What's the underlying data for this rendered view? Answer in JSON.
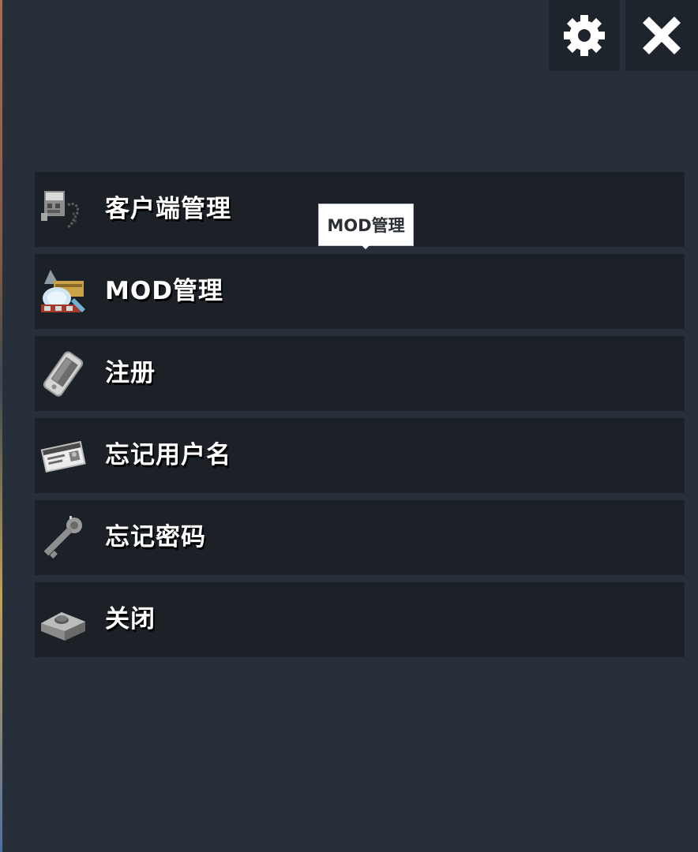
{
  "header": {
    "settings_icon": "gear-icon",
    "close_icon": "close-icon"
  },
  "tooltip": {
    "text": "MOD管理"
  },
  "menu": {
    "items": [
      {
        "label": "客户端管理",
        "icon": "client-device-icon"
      },
      {
        "label": "MOD管理",
        "icon": "mod-tools-icon"
      },
      {
        "label": "注册",
        "icon": "phone-icon"
      },
      {
        "label": "忘记用户名",
        "icon": "id-card-icon"
      },
      {
        "label": "忘记密码",
        "icon": "key-icon"
      },
      {
        "label": "关闭",
        "icon": "power-button-icon"
      }
    ]
  },
  "colors": {
    "background": "#27303a",
    "item_background": "#1b2127",
    "button_background": "#1d242b",
    "text": "#ffffff",
    "tooltip_background": "#ffffff"
  }
}
